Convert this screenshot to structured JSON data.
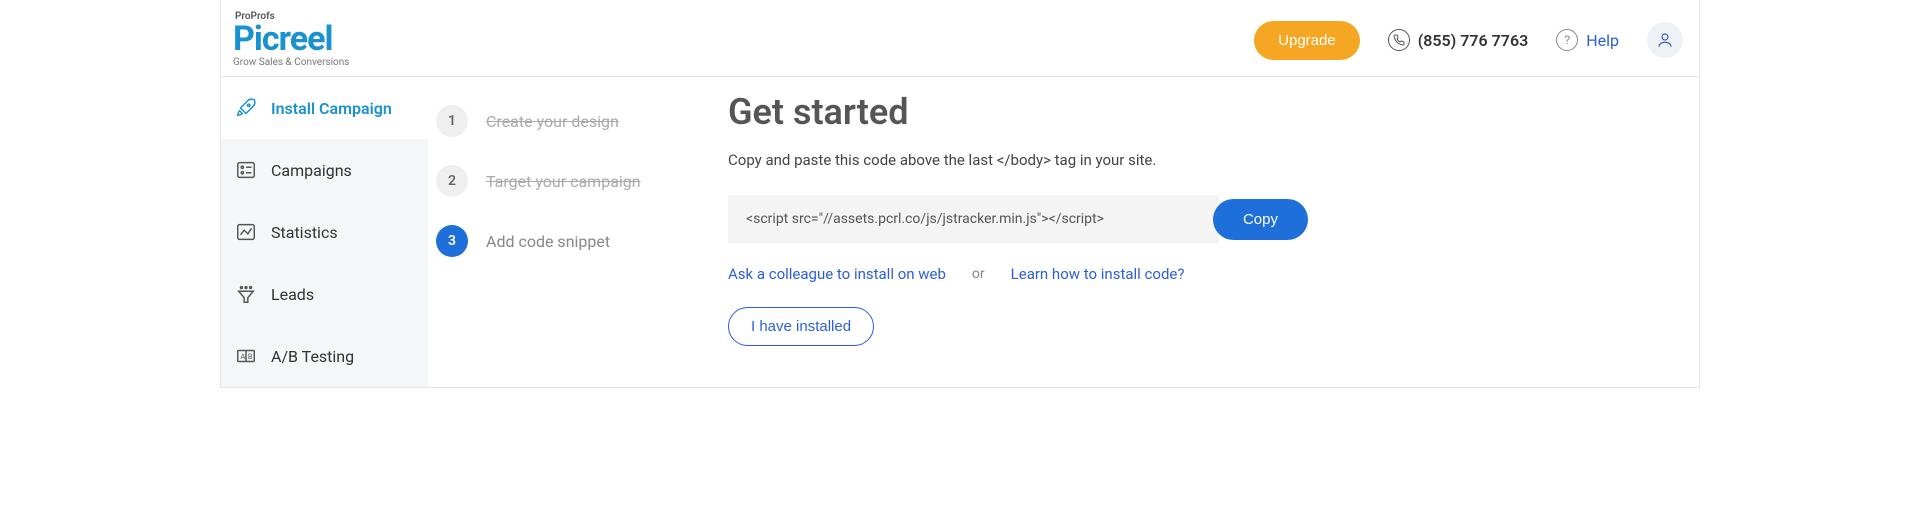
{
  "header": {
    "logo_top": "ProProfs",
    "logo_main": "Picreel",
    "logo_sub": "Grow Sales & Conversions",
    "upgrade_label": "Upgrade",
    "phone": "(855) 776 7763",
    "help_label": "Help"
  },
  "sidebar": {
    "items": [
      {
        "label": "Install Campaign"
      },
      {
        "label": "Campaigns"
      },
      {
        "label": "Statistics"
      },
      {
        "label": "Leads"
      },
      {
        "label": "A/B Testing"
      }
    ]
  },
  "steps": [
    {
      "num": "1",
      "label": "Create your design"
    },
    {
      "num": "2",
      "label": "Target your campaign"
    },
    {
      "num": "3",
      "label": "Add code snippet"
    }
  ],
  "main": {
    "title": "Get started",
    "desc": "Copy and paste this code above the last </body> tag in your site.",
    "code": "<script src=\"//assets.pcrl.co/js/jstracker.min.js\"></script>",
    "copy_label": "Copy",
    "ask_colleague_label": "Ask a colleague to install on web",
    "or_label": "or",
    "learn_label": "Learn how to install code?",
    "installed_label": "I have installed"
  }
}
